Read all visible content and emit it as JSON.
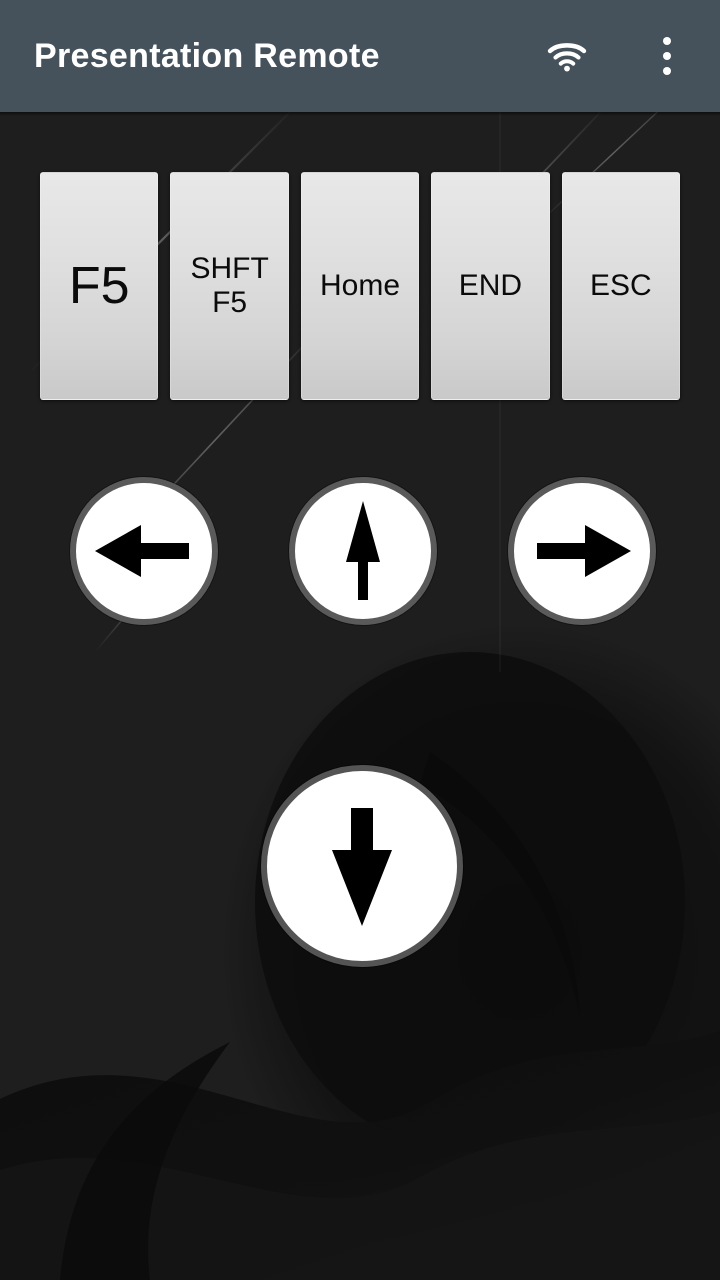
{
  "app": {
    "title": "Presentation Remote",
    "bar_color": "#45525c",
    "background_color": "#1e1e1e",
    "key_face_color": "#e0e0e0",
    "accent_color": "#ffffff"
  },
  "appbar": {
    "title": "Presentation Remote",
    "actions": [
      {
        "name": "wifi-icon",
        "label": "Wi-Fi"
      },
      {
        "name": "overflow-menu-icon",
        "label": "More options"
      }
    ]
  },
  "keys": [
    {
      "id": "f5",
      "label": "F5",
      "size": "big"
    },
    {
      "id": "shiftf5",
      "label": "SHFT\nF5",
      "size": "normal"
    },
    {
      "id": "home",
      "label": "Home",
      "size": "normal"
    },
    {
      "id": "end",
      "label": "END",
      "size": "normal"
    },
    {
      "id": "esc",
      "label": "ESC",
      "size": "normal"
    }
  ],
  "arrows": [
    {
      "id": "left",
      "icon": "arrow-left-icon",
      "label": "Left"
    },
    {
      "id": "up",
      "icon": "arrow-up-icon",
      "label": "Up"
    },
    {
      "id": "right",
      "icon": "arrow-right-icon",
      "label": "Right"
    }
  ],
  "primary_arrow": {
    "id": "down",
    "icon": "arrow-down-icon",
    "label": "Down"
  }
}
